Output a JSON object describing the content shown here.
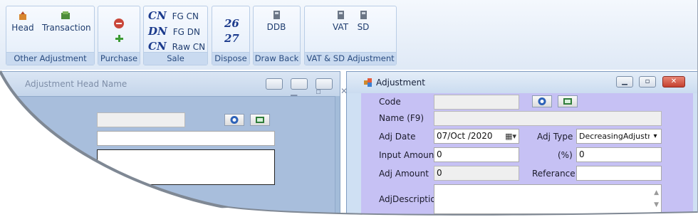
{
  "ribbon": {
    "other_adjustment": {
      "label": "Other Adjustment",
      "head": "Head",
      "transaction": "Transaction"
    },
    "purchase": {
      "label": "Purchase"
    },
    "sale": {
      "label": "Sale",
      "rows": [
        {
          "glyph": "CN",
          "text": "FG CN"
        },
        {
          "glyph": "DN",
          "text": "FG DN"
        },
        {
          "glyph": "CN",
          "text": "Raw CN"
        }
      ]
    },
    "dispose": {
      "label": "Dispose",
      "top": "26",
      "bottom": "27"
    },
    "draw_back": {
      "label": "Draw Back",
      "ddb": "DDB"
    },
    "vat_sd": {
      "label": "VAT & SD Adjustment",
      "vat": "VAT",
      "sd": "SD"
    }
  },
  "head_window": {
    "title": "Adjustment Head Name"
  },
  "adjustment_window": {
    "title": "Adjustment",
    "code_label": "Code",
    "code_value": "",
    "name_label": "Name (F9)",
    "name_value": "",
    "adj_date_label": "Adj Date",
    "adj_date_value": "07/Oct /2020",
    "adj_type_label": "Adj Type",
    "adj_type_value": "DecreasingAdjustme",
    "input_amount_label": "Input Amount",
    "input_amount_value": "0",
    "percent_label": "(%)",
    "percent_value": "0",
    "adj_amount_label": "Adj Amount",
    "adj_amount_value": "0",
    "referance_label": "Referance",
    "referance_value": "",
    "description_label": "AdjDescription",
    "description_value": ""
  },
  "colors": {
    "accent": "#1b3a8c",
    "form_bg": "#c6c1f4",
    "close_red": "#c9473a"
  },
  "icons": [
    "head-icon",
    "transaction-icon",
    "purchase-remove-icon",
    "purchase-add-icon",
    "ddb-icon",
    "vat-icon",
    "sd-icon",
    "search-icon",
    "image-icon",
    "minimize-icon",
    "maximize-icon",
    "close-icon",
    "calendar-icon",
    "chevron-down-icon"
  ]
}
